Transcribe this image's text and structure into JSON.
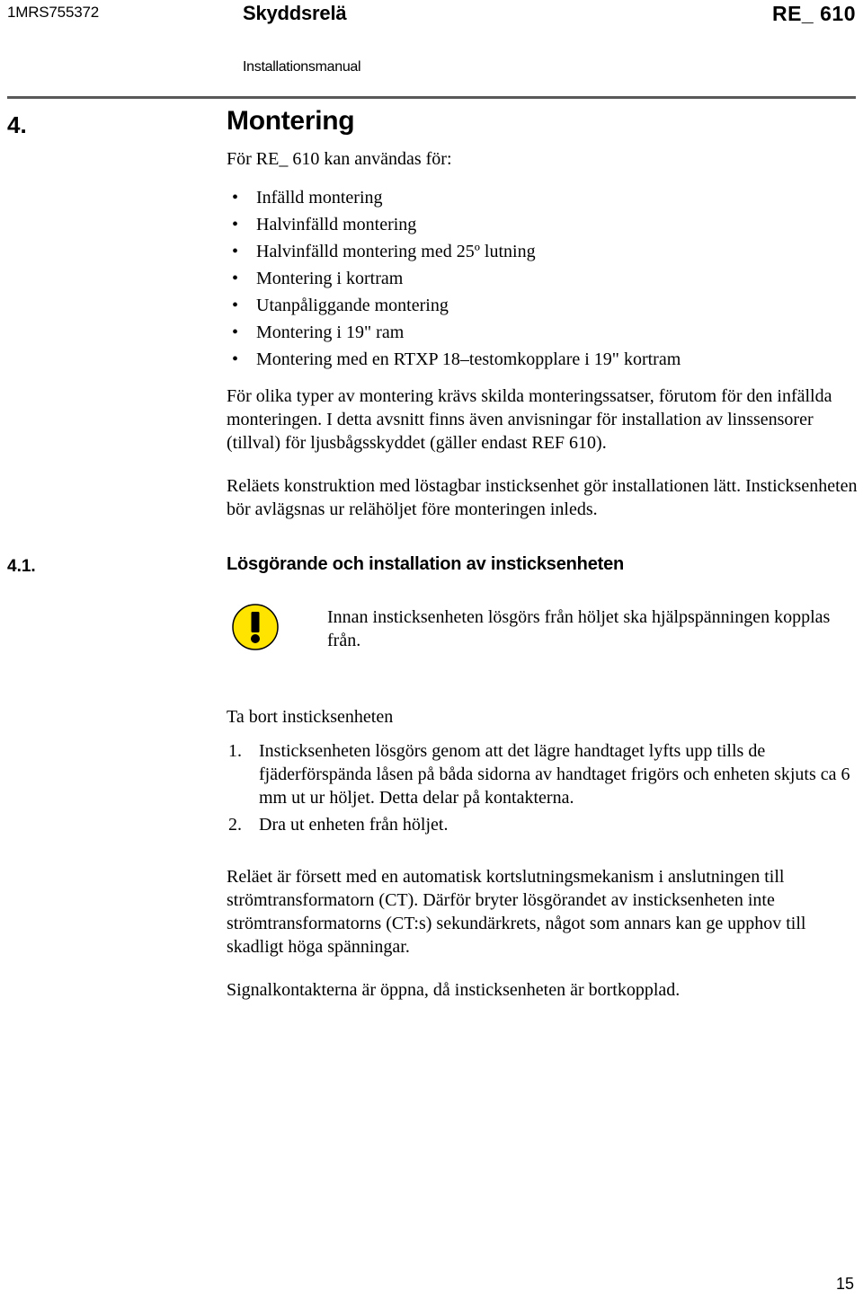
{
  "header": {
    "doc_id": "1MRS755372",
    "title": "Skyddsrelä",
    "product": "RE_ 610",
    "subtitle": "Installationsmanual"
  },
  "section_4": {
    "number": "4.",
    "title": "Montering",
    "intro": "För RE_ 610 kan användas för:",
    "bullets": [
      "Infälld montering",
      "Halvinfälld montering",
      "Halvinfälld montering med 25º lutning",
      "Montering i kortram",
      "Utanpåliggande montering",
      "Montering i 19\" ram",
      "Montering med en RTXP 18–testomkopplare i 19\" kortram"
    ],
    "bullet_glyph": "•",
    "para_1": "För olika typer av montering krävs skilda monteringssatser, förutom för den infällda monteringen. I detta avsnitt finns även anvisningar för installation av linssensorer (tillval) för ljusbågsskyddet (gäller endast REF 610).",
    "para_2": "Reläets konstruktion med löstagbar insticksenhet gör installationen lätt. Insticksenheten bör avlägsnas ur relähöljet före monteringen inleds."
  },
  "section_4_1": {
    "number": "4.1.",
    "title": "Lösgörande och installation av insticksenheten",
    "warning": {
      "icon": "warning-exclamation-icon",
      "icon_color": "#FFE400",
      "text": "Innan insticksenheten lösgörs från höljet ska hjälpspänningen kopplas från."
    },
    "subheading": "Ta bort insticksenheten",
    "steps": [
      {
        "marker": "1.",
        "text": "Insticksenheten lösgörs genom att det lägre handtaget lyfts upp tills de fjäderförspända låsen på båda sidorna av handtaget frigörs och enheten skjuts ca 6 mm ut ur höljet. Detta delar på kontakterna."
      },
      {
        "marker": "2.",
        "text": "Dra ut enheten från höljet."
      }
    ],
    "para_3": "Reläet är försett med en automatisk kortslutningsmekanism i anslutningen till strömtransformatorn (CT). Därför bryter lösgörandet av insticksenheten inte strömtransformatorns (CT:s) sekundärkrets, något som annars kan ge upphov till skadligt höga spänningar.",
    "para_4": "Signalkontakterna är öppna, då insticksenheten är bortkopplad."
  },
  "footer": {
    "page_number": "15"
  }
}
